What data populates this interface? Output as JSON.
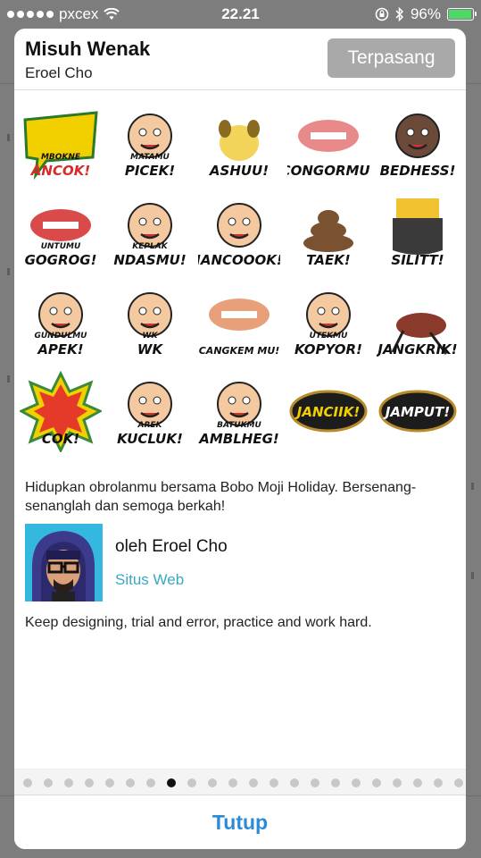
{
  "status_bar": {
    "carrier": "pxcex",
    "time": "22.21",
    "battery": "96%",
    "battery_level": 0.96
  },
  "pack": {
    "title": "Misuh Wenak",
    "author": "Eroel Cho",
    "install_label": "Terpasang"
  },
  "stickers": [
    {
      "icon": "mbokne-ancok-sticker",
      "label": "ANCOK!",
      "sub": "MBOKNE"
    },
    {
      "icon": "matamu-picek-sticker",
      "label": "PICEK!",
      "sub": "MATAMU"
    },
    {
      "icon": "ashuu-sticker",
      "label": "ASHUU!",
      "sub": ""
    },
    {
      "icon": "congormu-sticker",
      "label": "CONGORMU!",
      "sub": ""
    },
    {
      "icon": "bedhess-sticker",
      "label": "BEDHESS!",
      "sub": ""
    },
    {
      "icon": "untumu-gogrog-sticker",
      "label": "GOGROG!",
      "sub": "UNTUMU"
    },
    {
      "icon": "keplak-ndasmu-sticker",
      "label": "NDASMU!",
      "sub": "KEPLAK"
    },
    {
      "icon": "jancoook-sticker",
      "label": "JANCOOOK!",
      "sub": ""
    },
    {
      "icon": "taek-sticker",
      "label": "TAEK!",
      "sub": ""
    },
    {
      "icon": "silitt-sticker",
      "label": "SILITT!",
      "sub": ""
    },
    {
      "icon": "gundulmu-apek-sticker",
      "label": "APEK!",
      "sub": "GUNDULMU"
    },
    {
      "icon": "wk-wk-sticker",
      "label": "WK",
      "sub": "WK"
    },
    {
      "icon": "cangkem-mu-sticker",
      "label": "CANGKEM MU!",
      "sub": ""
    },
    {
      "icon": "utekmu-kopyor-sticker",
      "label": "KOPYOR!",
      "sub": "UTEKMU"
    },
    {
      "icon": "jangkrik-sticker",
      "label": "JANGKRIK!",
      "sub": ""
    },
    {
      "icon": "cok-sticker",
      "label": "COK!",
      "sub": ""
    },
    {
      "icon": "arek-kucluk-sticker",
      "label": "KUCLUK!",
      "sub": "AREK"
    },
    {
      "icon": "batukmu-amblheg-sticker",
      "label": "AMBLHEG!",
      "sub": "BATUKMU"
    },
    {
      "icon": "janciik-sticker",
      "label": "JANCIIK!",
      "sub": ""
    },
    {
      "icon": "jamput-sticker",
      "label": "JAMPUT!",
      "sub": ""
    }
  ],
  "description": "Hidupkan obrolanmu bersama Bobo Moji Holiday. Bersenang-senanglah dan semoga berkah!",
  "creator": {
    "by_label": "oleh Eroel Cho",
    "website_label": "Situs Web"
  },
  "tagline": "Keep designing, trial and error, practice and work hard.",
  "pager": {
    "count": 22,
    "active_index": 7
  },
  "footer": {
    "close_label": "Tutup"
  },
  "colors": {
    "accent": "#2a8bd8",
    "link": "#3aa7c7",
    "install_bg": "#a9a9a9",
    "battery": "#4cd964"
  }
}
